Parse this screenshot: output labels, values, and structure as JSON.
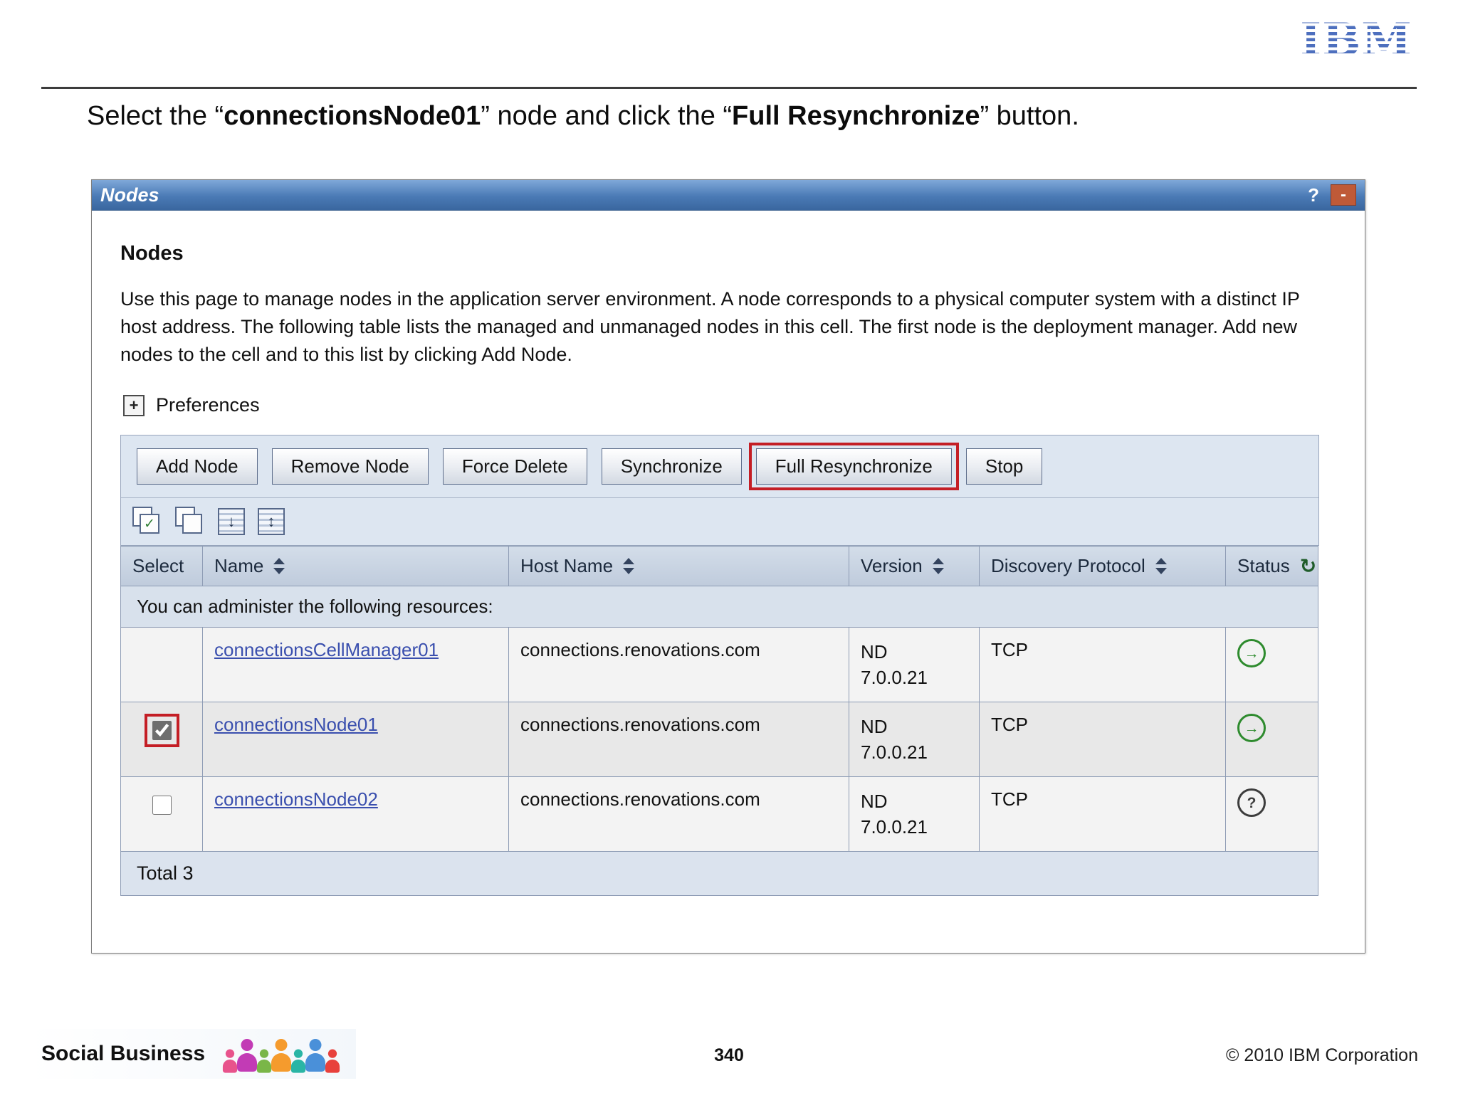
{
  "colors": {
    "annotation_red": "#c41e25",
    "link_blue": "#3a4fae",
    "status_green": "#2e8b2e"
  },
  "slide": {
    "logo_text": "IBM",
    "title": {
      "prefix": "Select the “",
      "bold1": "connectionsNode01",
      "middle": "” node and click the “",
      "bold2": "Full Resynchronize",
      "suffix": "” button."
    },
    "footer": {
      "brand": "Social Business",
      "page": "340",
      "copyright": "© 2010 IBM Corporation"
    }
  },
  "window": {
    "title": "Nodes",
    "controls": {
      "help": "?",
      "collapse": "-"
    },
    "heading": "Nodes",
    "description": "Use this page to manage nodes in the application server environment. A node corresponds to a physical computer system with a distinct IP host address. The following table lists the managed and unmanaged nodes in this cell. The first node is the deployment manager. Add new nodes to the cell and to this list by clicking Add Node.",
    "preferences": {
      "label": "Preferences",
      "expand_glyph": "+"
    },
    "toolbar_buttons": [
      {
        "label": "Add Node",
        "highlighted": false
      },
      {
        "label": "Remove Node",
        "highlighted": false
      },
      {
        "label": "Force Delete",
        "highlighted": false
      },
      {
        "label": "Synchronize",
        "highlighted": false
      },
      {
        "label": "Full Resynchronize",
        "highlighted": true
      },
      {
        "label": "Stop",
        "highlighted": false
      }
    ],
    "icon_row": [
      {
        "name": "select-all",
        "glyph": "✓"
      },
      {
        "name": "deselect-all",
        "glyph": ""
      },
      {
        "name": "show-filter",
        "glyph": "↓"
      },
      {
        "name": "hide-filter",
        "glyph": "↕"
      }
    ],
    "table": {
      "headers": [
        {
          "label": "Select"
        },
        {
          "label": "Name"
        },
        {
          "label": "Host Name"
        },
        {
          "label": "Version"
        },
        {
          "label": "Discovery Protocol"
        },
        {
          "label": "Status",
          "refresh_icon": "↻"
        }
      ],
      "admin_note": "You can administer the following resources:",
      "rows": [
        {
          "name": "connectionsCellManager01",
          "host": "connections.renovations.com",
          "version_line1": "ND",
          "version_line2": "7.0.0.21",
          "protocol": "TCP",
          "status": "started",
          "status_glyph": "→",
          "selected": false,
          "highlighted": false
        },
        {
          "name": "connectionsNode01",
          "host": "connections.renovations.com",
          "version_line1": "ND",
          "version_line2": "7.0.0.21",
          "protocol": "TCP",
          "status": "started",
          "status_glyph": "→",
          "selected": true,
          "highlighted": true
        },
        {
          "name": "connectionsNode02",
          "host": "connections.renovations.com",
          "version_line1": "ND",
          "version_line2": "7.0.0.21",
          "protocol": "TCP",
          "status": "unknown",
          "status_glyph": "?",
          "selected": false,
          "highlighted": false
        }
      ],
      "total": "Total 3"
    }
  }
}
